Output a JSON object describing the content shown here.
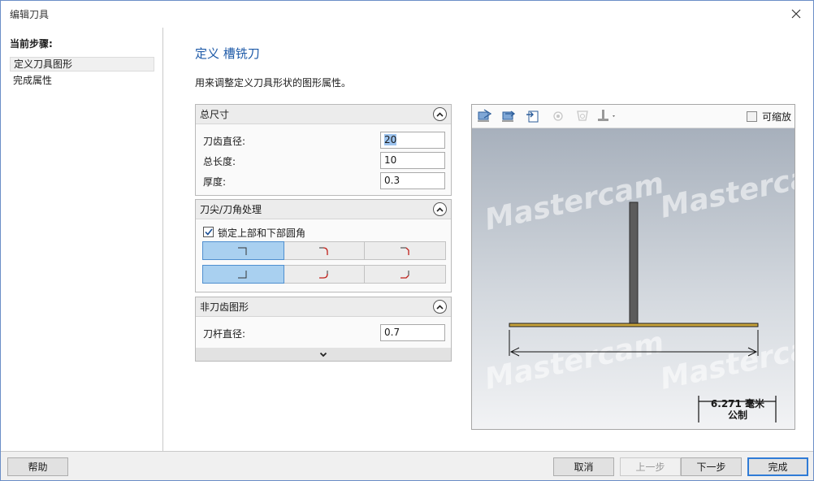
{
  "window": {
    "title": "编辑刀具"
  },
  "sidebar": {
    "title": "当前步骤:",
    "steps": [
      {
        "label": "定义刀具图形"
      },
      {
        "label": "完成属性"
      }
    ]
  },
  "main": {
    "heading": "定义 槽铣刀",
    "description": "用来调整定义刀具形状的图形属性。",
    "overall": {
      "title": "总尺寸",
      "fields": [
        {
          "label": "刀齿直径:",
          "value": "20"
        },
        {
          "label": "总长度:",
          "value": "10"
        },
        {
          "label": "厚度:",
          "value": "0.3"
        }
      ]
    },
    "corner": {
      "title": "刀尖/刀角处理",
      "lock_label": "锁定上部和下部圆角",
      "lock_checked": true
    },
    "non_cutting": {
      "title": "非刀齿图形",
      "fields": [
        {
          "label": "刀杆直径:",
          "value": "0.7"
        }
      ]
    }
  },
  "viewer": {
    "zoom_label": "可缩放",
    "watermark": "Mastercam",
    "scale_value": "6.271 毫米",
    "scale_unit": "公制",
    "colors": {
      "shaft": "#5c5c5c",
      "blade": "#c8a33a"
    }
  },
  "footer": {
    "help": "帮助",
    "cancel": "取消",
    "back": "上一步",
    "next": "下一步",
    "finish": "完成"
  }
}
